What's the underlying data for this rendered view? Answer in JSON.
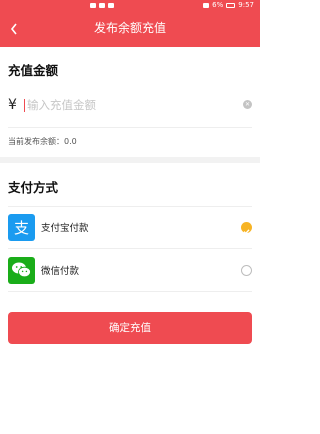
{
  "status_bar": {
    "battery_level": "6%",
    "time": "9:57"
  },
  "header": {
    "title": "发布余额充值",
    "back_icon": "chevron-left-icon"
  },
  "recharge": {
    "section_title": "充值金额",
    "currency_symbol": "¥",
    "input_placeholder": "输入充值金额",
    "input_value": "",
    "current_balance_text": "当前发布余额：0.0"
  },
  "payment": {
    "section_title": "支付方式",
    "methods": [
      {
        "label": "支付宝付款",
        "icon": "alipay-icon",
        "selected": true
      },
      {
        "label": "微信付款",
        "icon": "wechat-icon",
        "selected": false
      }
    ]
  },
  "confirm_button_label": "确定充值",
  "colors": {
    "primary_red": "#ef4b51",
    "selected_radio": "#f7b425",
    "alipay_blue": "#1a9bf0",
    "wechat_green": "#1aad19"
  }
}
